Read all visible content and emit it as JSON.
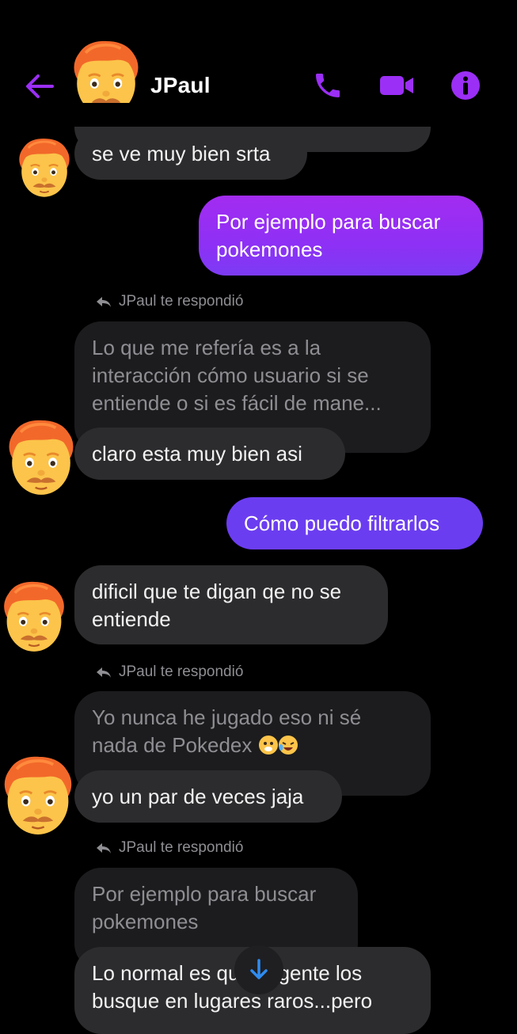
{
  "header": {
    "contact_name": "JPaul",
    "icons": [
      "back-arrow-icon",
      "phone-icon",
      "video-camera-icon",
      "info-icon"
    ]
  },
  "colors": {
    "accent": "#9b2ff5",
    "outgoing_gradient_start": "#a32cf0",
    "outgoing_gradient_end": "#7c3bf3",
    "outgoing_solid": "#6b3df0",
    "incoming": "#2c2c2e",
    "quoted": "#1c1c1e"
  },
  "messages": [
    {
      "from": "them",
      "text": "se ve muy bien srta"
    },
    {
      "from": "me",
      "text": "Por ejemplo para buscar\npokemones"
    },
    {
      "from": "them",
      "reply_label": "JPaul te respondió",
      "quoted": "Lo que me refería es a la\ninteracción cómo usuario si se\nentiende o si es fácil de mane...",
      "text": "claro esta muy bien asi"
    },
    {
      "from": "me",
      "text": "Cómo puedo filtrarlos"
    },
    {
      "from": "them",
      "text": "dificil que te digan qe no se\nentiende"
    },
    {
      "from": "them",
      "reply_label": "JPaul te respondió",
      "quoted": "Yo nunca he jugado eso ni sé\nnada de Pokedex",
      "text": "yo un par de veces jaja"
    },
    {
      "from": "them",
      "reply_label": "JPaul te respondió",
      "quoted": "Por ejemplo para buscar\npokemones",
      "text": "Lo normal es que la gente los\nbusque en lugares raros...pero"
    }
  ]
}
